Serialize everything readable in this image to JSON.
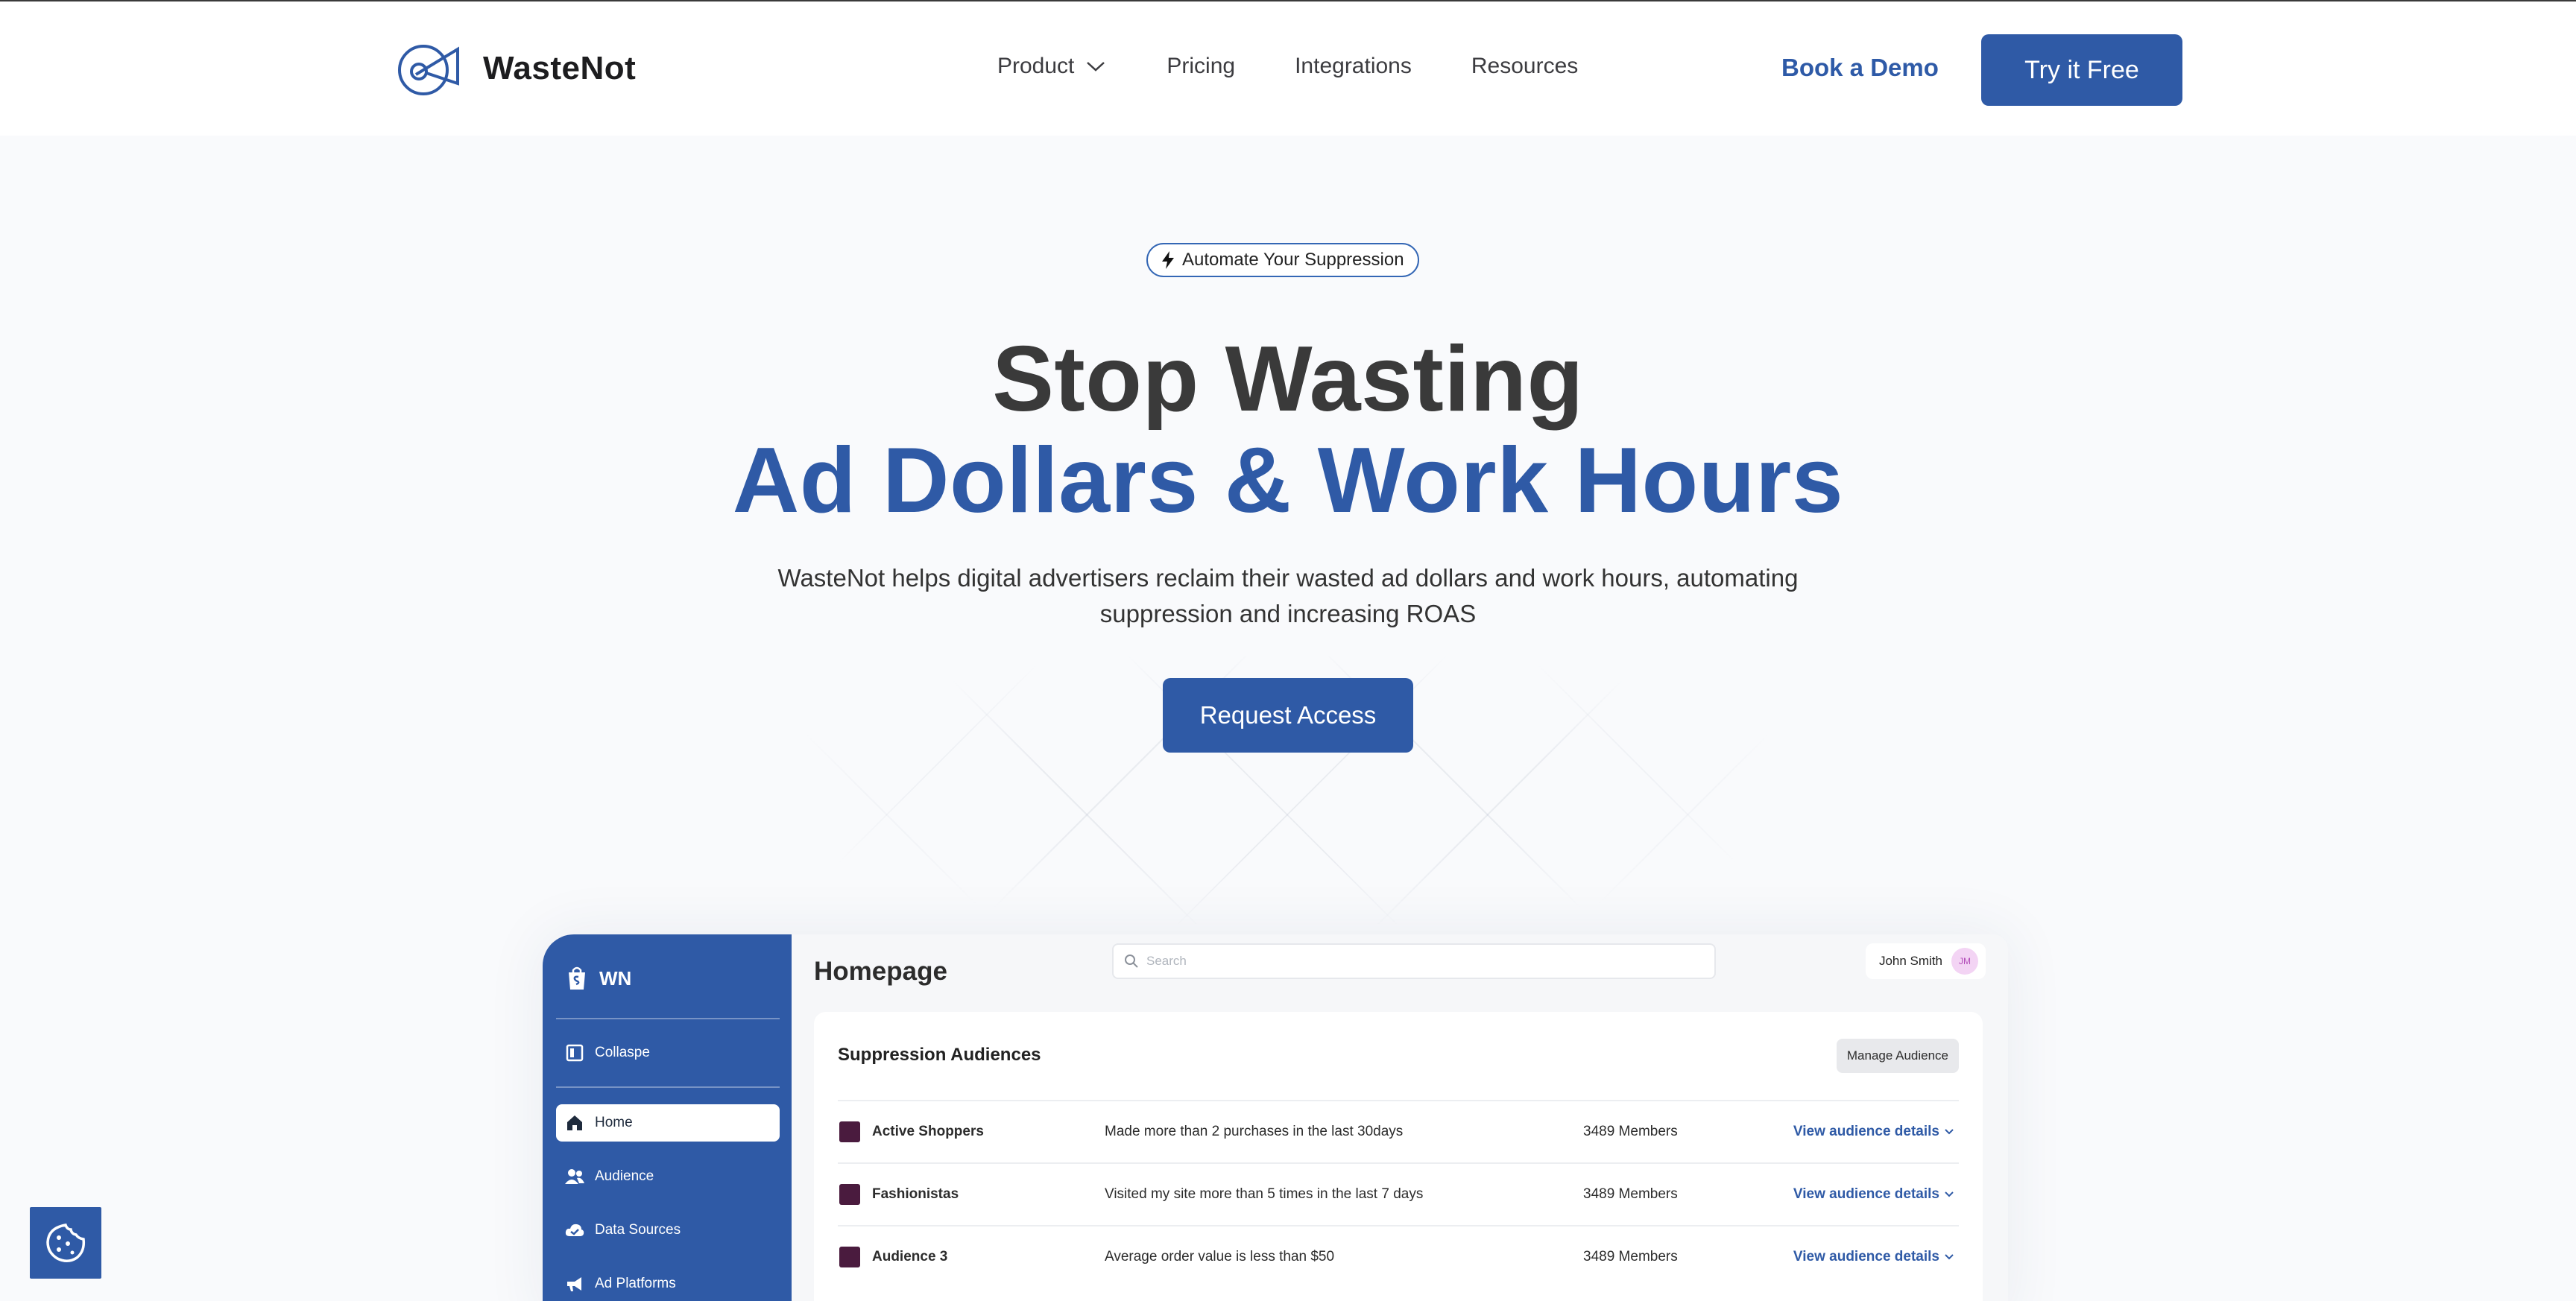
{
  "brand": {
    "name": "WasteNot",
    "logo_icon": "megaphone-circle-icon",
    "color": "#2f5aa6"
  },
  "nav": {
    "items": [
      {
        "label": "Product",
        "has_dropdown": true
      },
      {
        "label": "Pricing"
      },
      {
        "label": "Integrations"
      },
      {
        "label": "Resources"
      }
    ],
    "book_demo": "Book a Demo",
    "try_free": "Try it Free"
  },
  "hero": {
    "badge": "Automate Your Suppression",
    "badge_icon": "lightning-bolt-icon",
    "title_line1": "Stop Wasting",
    "title_line2": "Ad Dollars & Work Hours",
    "subtitle": "WasteNot helps digital advertisers reclaim their wasted ad dollars and work hours, automating suppression and increasing ROAS",
    "cta": "Request Access"
  },
  "app": {
    "sidebar": {
      "brand": "WN",
      "items": [
        {
          "label": "Collaspe",
          "icon": "collapse-panel-icon"
        },
        {
          "label": "Home",
          "icon": "home-icon",
          "active": true
        },
        {
          "label": "Audience",
          "icon": "users-icon"
        },
        {
          "label": "Data Sources",
          "icon": "cloud-check-icon"
        },
        {
          "label": "Ad Platforms",
          "icon": "megaphone-icon"
        }
      ]
    },
    "header": {
      "title": "Homepage",
      "search_placeholder": "Search",
      "user_name": "John Smith",
      "user_initials": "JM"
    },
    "card": {
      "title": "Suppression Audiences",
      "manage_button": "Manage Audience",
      "rows": [
        {
          "name": "Active Shoppers",
          "description": "Made more than 2 purchases in the last 30days",
          "members": "3489 Members",
          "link": "View audience details"
        },
        {
          "name": "Fashionistas",
          "description": "Visited my site more than 5 times in the last 7 days",
          "members": "3489 Members",
          "link": "View audience details"
        },
        {
          "name": "Audience 3",
          "description": "Average order value is less than $50",
          "members": "3489 Members",
          "link": "View audience details"
        }
      ]
    }
  },
  "cookie_icon": "cookie-icon"
}
